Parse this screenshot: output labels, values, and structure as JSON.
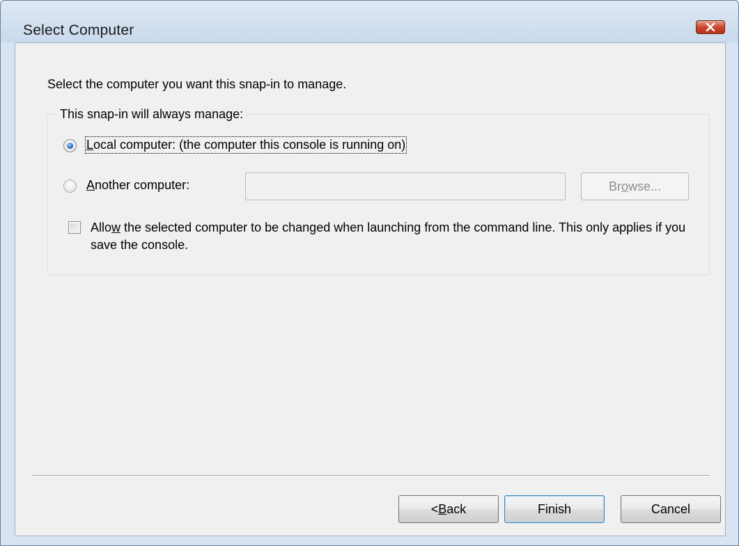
{
  "window": {
    "title": "Select Computer"
  },
  "dialog": {
    "instruction": "Select the computer you want this snap-in to manage.",
    "group_label": "This snap-in will always manage:",
    "local_option": {
      "accel": "L",
      "rest": "ocal computer:  (the computer this console is running on)",
      "checked": true
    },
    "another_option": {
      "accel": "A",
      "rest": "nother computer:",
      "checked": false
    },
    "computer_name": {
      "value": "",
      "placeholder": ""
    },
    "browse_button": {
      "pre": "Br",
      "accel": "o",
      "post": "wse..."
    },
    "allow_change": {
      "pre": "Allo",
      "accel": "w",
      "post": " the selected computer to be changed when launching from the command line.  This only applies if you save the console.",
      "checked": false
    }
  },
  "footer": {
    "back_button": {
      "pre": "< ",
      "accel": "B",
      "post": "ack"
    },
    "finish_label": "Finish",
    "cancel_label": "Cancel"
  },
  "colors": {
    "frame": "#d8e4f1",
    "client_bg": "#f0f0f0",
    "close_button": "#c9462c",
    "default_button_border": "#3c7fb1"
  }
}
